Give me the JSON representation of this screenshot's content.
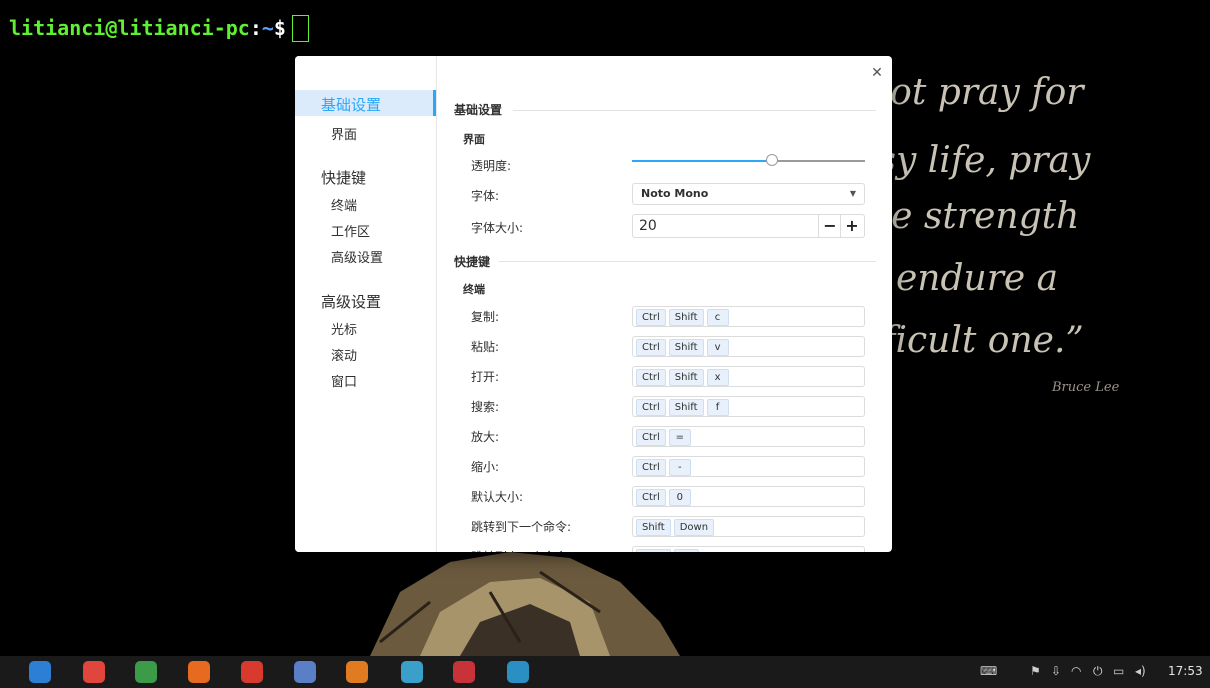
{
  "terminal": {
    "user_host": "litianci@litianci-pc",
    "colon": ":",
    "path": "~",
    "dollar": "$"
  },
  "wallpaper": {
    "quote_lines": [
      "not pray for",
      "asy life, pray",
      "he strength",
      "endure a",
      "fficult one.”"
    ],
    "author": "Bruce Lee"
  },
  "dialog": {
    "close_icon": "close-icon",
    "nav": {
      "groups": [
        {
          "label": "基础设置",
          "items": [
            "界面"
          ]
        },
        {
          "label": "快捷键",
          "items": [
            "终端",
            "工作区",
            "高级设置"
          ]
        },
        {
          "label": "高级设置",
          "items": [
            "光标",
            "滚动",
            "窗口"
          ]
        }
      ],
      "selected": "基础设置"
    },
    "basic": {
      "title": "基础设置",
      "interface_title": "界面",
      "opacity_label": "透明度:",
      "opacity_value": 0.6,
      "font_label": "字体:",
      "font_value": "Noto Mono",
      "font_size_label": "字体大小:",
      "font_size_value": "20",
      "minus_label": "−",
      "plus_label": "+"
    },
    "shortcuts": {
      "title": "快捷键",
      "terminal_title": "终端",
      "rows": [
        {
          "label": "复制:",
          "keys": [
            "Ctrl",
            "Shift",
            "c"
          ]
        },
        {
          "label": "粘贴:",
          "keys": [
            "Ctrl",
            "Shift",
            "v"
          ]
        },
        {
          "label": "打开:",
          "keys": [
            "Ctrl",
            "Shift",
            "x"
          ]
        },
        {
          "label": "搜索:",
          "keys": [
            "Ctrl",
            "Shift",
            "f"
          ]
        },
        {
          "label": "放大:",
          "keys": [
            "Ctrl",
            "="
          ]
        },
        {
          "label": "缩小:",
          "keys": [
            "Ctrl",
            "-"
          ]
        },
        {
          "label": "默认大小:",
          "keys": [
            "Ctrl",
            "0"
          ]
        },
        {
          "label": "跳转到下一个命令:",
          "keys": [
            "Shift",
            "Down"
          ]
        },
        {
          "label": "跳转到上一个命令:",
          "keys": [
            "Shift",
            "Up"
          ]
        }
      ]
    }
  },
  "taskbar": {
    "apps": [
      {
        "name": "launcher-icon",
        "color": "#2d7fd6"
      },
      {
        "name": "record-icon",
        "color": "#e0463b"
      },
      {
        "name": "archive-icon",
        "color": "#3b9b48"
      },
      {
        "name": "firefox-icon",
        "color": "#e66a1f"
      },
      {
        "name": "netease-music-icon",
        "color": "#d83a2e"
      },
      {
        "name": "rstudio-icon",
        "color": "#5b7fc7"
      },
      {
        "name": "matlab-icon",
        "color": "#e07b21"
      },
      {
        "name": "system-monitor-icon",
        "color": "#3aa0c9"
      },
      {
        "name": "terminal-icon",
        "color": "#c8333a"
      },
      {
        "name": "file-manager-icon",
        "color": "#2a8fc2"
      }
    ],
    "clock": "17:53"
  }
}
